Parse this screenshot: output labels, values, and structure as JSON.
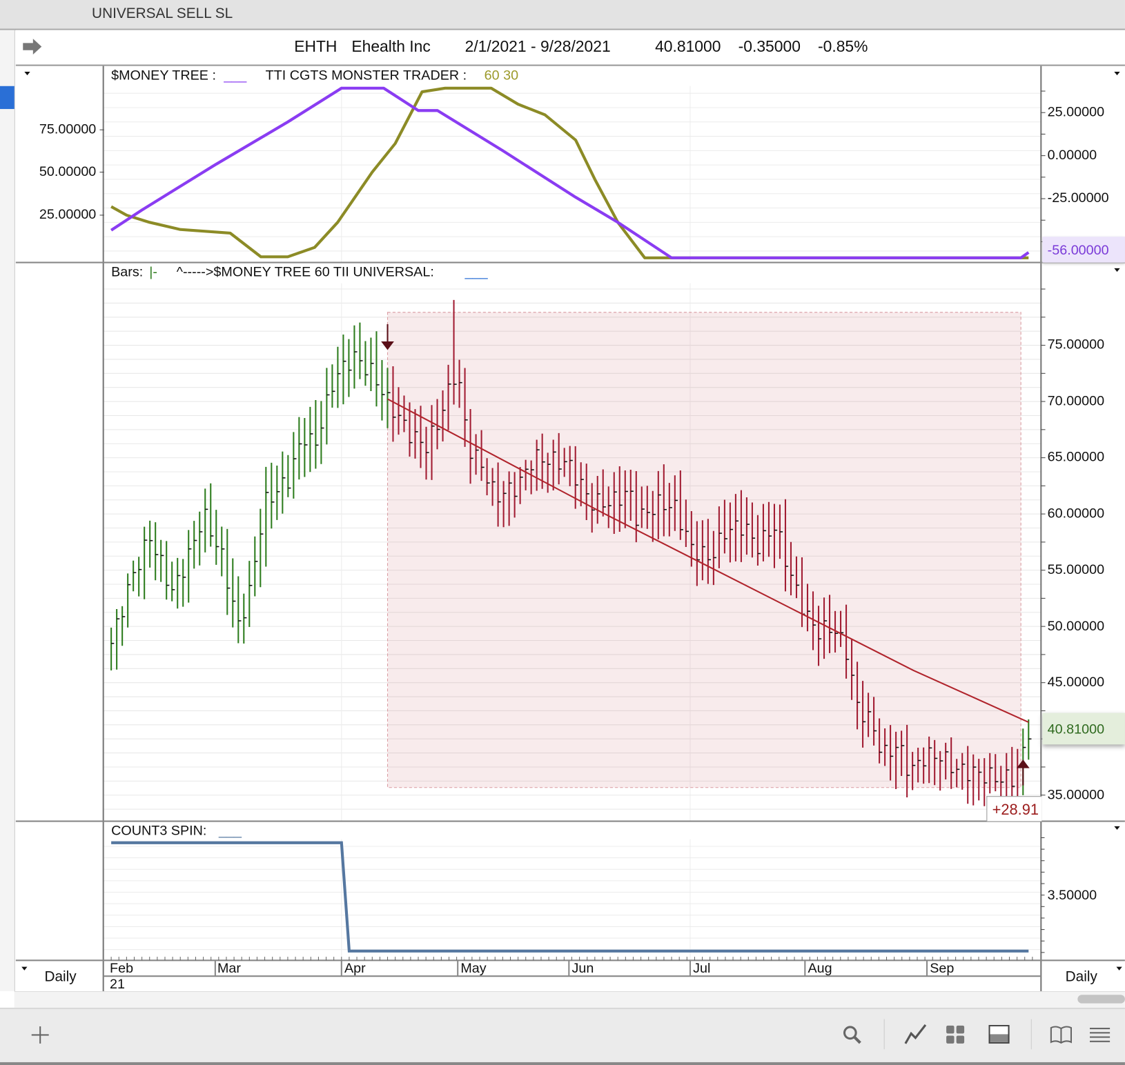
{
  "window_title": "UNIVERSAL SELL SL",
  "header": {
    "symbol": "EHTH",
    "name": "Ehealth Inc",
    "range": "2/1/2021 - 9/28/2021",
    "last": "40.81000",
    "change": "-0.35000",
    "change_pct": "-0.85%"
  },
  "top_pane": {
    "label1": "$MONEY TREE :",
    "label1_line": "___",
    "label2": "TTI CGTS MONSTER TRADER :",
    "label2_params": "60 30",
    "left_axis": [
      "75.00000",
      "50.00000",
      "25.00000"
    ],
    "right_axis": [
      "25.00000",
      "0.00000",
      "-25.00000"
    ],
    "right_badge": "-56.00000"
  },
  "price_pane": {
    "label_bars": "Bars:",
    "label_bars_glyph": "|-",
    "label2": "^----->$MONEY TREE 60 TII UNIVERSAL:",
    "label2_line": "___",
    "right_axis": [
      "75.00000",
      "70.00000",
      "65.00000",
      "60.00000",
      "55.00000",
      "50.00000",
      "45.00000",
      "35.00000"
    ],
    "last_badge": "40.81000",
    "trade_result": "+28.91"
  },
  "count_pane": {
    "label": "COUNT3 SPIN:",
    "label_line": "___",
    "right_axis": [
      "3.50000"
    ]
  },
  "time_axis": {
    "months": [
      "Feb",
      "Mar",
      "Apr",
      "May",
      "Jun",
      "Jul",
      "Aug",
      "Sep"
    ],
    "year": "21",
    "left_period": "Daily",
    "right_period": "Daily"
  },
  "colors": {
    "purple": "#8a3cf2",
    "olive": "#8c8b26",
    "bull": "#2e7d1e",
    "bear": "#a21d33",
    "count": "#5577a0",
    "accent_blue": "#2a6fd6"
  },
  "icons": [
    "plus-icon",
    "search-icon",
    "chart-line-icon",
    "grid-icon",
    "panel-icon",
    "book-icon",
    "menu-icon"
  ],
  "chart_data": {
    "type": "line",
    "x_unit": "days since 2021-02-01",
    "money_tree": [
      [
        0,
        16.2
      ],
      [
        8,
        28
      ],
      [
        27,
        54.4
      ],
      [
        46,
        79.6
      ],
      [
        60,
        99.4
      ],
      [
        71,
        99.4
      ],
      [
        80,
        86.3
      ],
      [
        85,
        86.3
      ],
      [
        102,
        62.8
      ],
      [
        121,
        35.5
      ],
      [
        132,
        20.8
      ],
      [
        146,
        0
      ],
      [
        237,
        0
      ],
      [
        239,
        3.2
      ]
    ],
    "monster_trader": [
      [
        0,
        30
      ],
      [
        4,
        25
      ],
      [
        10,
        20.8
      ],
      [
        18,
        16.6
      ],
      [
        31,
        14.5
      ],
      [
        39,
        0.6
      ],
      [
        46,
        0.6
      ],
      [
        53,
        6.1
      ],
      [
        59,
        20.8
      ],
      [
        68,
        50.2
      ],
      [
        74,
        67
      ],
      [
        81,
        97.3
      ],
      [
        87,
        99.4
      ],
      [
        99,
        99.4
      ],
      [
        106,
        90
      ],
      [
        113,
        83.8
      ],
      [
        121,
        69
      ],
      [
        126,
        46
      ],
      [
        132,
        20.8
      ],
      [
        139,
        0
      ],
      [
        239,
        0
      ]
    ],
    "price_closes": [
      [
        0,
        48.5
      ],
      [
        5,
        54
      ],
      [
        10,
        58
      ],
      [
        16,
        53
      ],
      [
        21,
        57
      ],
      [
        24,
        60
      ],
      [
        29,
        56
      ],
      [
        33,
        50
      ],
      [
        36,
        53
      ],
      [
        40,
        61
      ],
      [
        46,
        63
      ],
      [
        50,
        67
      ],
      [
        53,
        66
      ],
      [
        58,
        72
      ],
      [
        63,
        74
      ],
      [
        68,
        72.5
      ],
      [
        72,
        70
      ],
      [
        78,
        67
      ],
      [
        82,
        66
      ],
      [
        85,
        68
      ],
      [
        88,
        71
      ],
      [
        90,
        73
      ],
      [
        93,
        66
      ],
      [
        97,
        64
      ],
      [
        100,
        61.5
      ],
      [
        106,
        62.5
      ],
      [
        110,
        65
      ],
      [
        119,
        64.5
      ],
      [
        125,
        61
      ],
      [
        130,
        61
      ],
      [
        135,
        62
      ],
      [
        137,
        59.5
      ],
      [
        143,
        61
      ],
      [
        147,
        60.5
      ],
      [
        151,
        57
      ],
      [
        156,
        56
      ],
      [
        160,
        58.5
      ],
      [
        165,
        59
      ],
      [
        168,
        57
      ],
      [
        173,
        59
      ],
      [
        177,
        54.5
      ],
      [
        181,
        51
      ],
      [
        184,
        49.5
      ],
      [
        188,
        50
      ],
      [
        192,
        47.5
      ],
      [
        194,
        43
      ],
      [
        198,
        41.5
      ],
      [
        201,
        38.5
      ],
      [
        205,
        39.5
      ],
      [
        208,
        37
      ],
      [
        212,
        38.5
      ],
      [
        216,
        38.5
      ],
      [
        220,
        37.3
      ],
      [
        225,
        37
      ],
      [
        231,
        36.5
      ],
      [
        235,
        36.5
      ],
      [
        237,
        38
      ],
      [
        239,
        40.81
      ]
    ],
    "spike": {
      "day": 89,
      "high": 79
    },
    "trade": {
      "entry_day": 72,
      "exit_day": 237,
      "box_high": 77.9,
      "box_low": 35.7
    },
    "trend_line": [
      [
        72,
        70.2
      ],
      [
        128,
        60.1
      ],
      [
        209,
        46.1
      ],
      [
        239,
        41.5
      ]
    ],
    "count3": [
      [
        0,
        4.23
      ],
      [
        60,
        4.23
      ],
      [
        62,
        2.72
      ],
      [
        239,
        2.72
      ]
    ]
  }
}
